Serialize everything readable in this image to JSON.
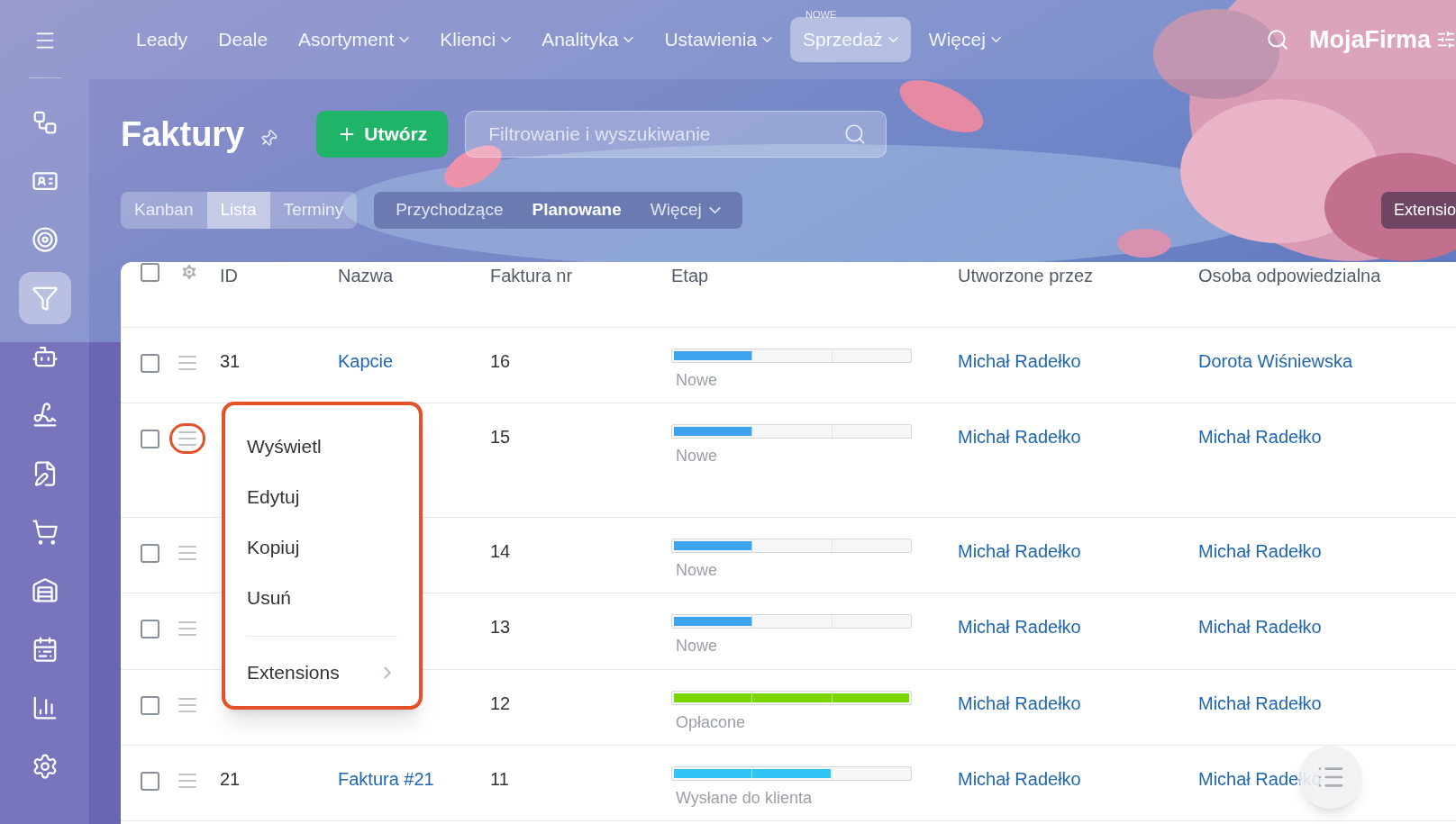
{
  "sidebar": {
    "items": [
      {
        "selected": false
      },
      {
        "selected": false
      },
      {
        "selected": false
      },
      {
        "selected": true
      },
      {
        "selected": false
      },
      {
        "selected": false
      },
      {
        "selected": false
      },
      {
        "selected": false
      },
      {
        "selected": false
      },
      {
        "selected": false
      },
      {
        "selected": false
      },
      {
        "selected": false
      }
    ]
  },
  "top_nav": {
    "items": [
      {
        "label": "Leady",
        "dropdown": false,
        "selected": false
      },
      {
        "label": "Deale",
        "dropdown": false,
        "selected": false
      },
      {
        "label": "Asortyment",
        "dropdown": true,
        "selected": false
      },
      {
        "label": "Klienci",
        "dropdown": true,
        "selected": false
      },
      {
        "label": "Analityka",
        "dropdown": true,
        "selected": false
      },
      {
        "label": "Ustawienia",
        "dropdown": true,
        "selected": false
      },
      {
        "label": "Sprzedaż",
        "dropdown": true,
        "selected": true,
        "badge": "NOWE"
      },
      {
        "label": "Więcej",
        "dropdown": true,
        "selected": false
      }
    ],
    "logo": "MojaFirma"
  },
  "header": {
    "title": "Faktury",
    "create_button": "Utwórz",
    "search": {
      "placeholder": "Filtrowanie i wyszukiwanie"
    },
    "view_tabs": [
      {
        "label": "Kanban",
        "selected": false
      },
      {
        "label": "Lista",
        "selected": true
      },
      {
        "label": "Terminy",
        "selected": false
      }
    ],
    "filter_tabs": [
      {
        "label": "Przychodzące",
        "selected": false,
        "dropdown": false
      },
      {
        "label": "Planowane",
        "selected": true,
        "dropdown": false
      },
      {
        "label": "Więcej",
        "selected": false,
        "dropdown": true
      }
    ],
    "extensions_button": "Extensio"
  },
  "table": {
    "all_checked": false,
    "columns": [
      "ID",
      "Nazwa",
      "Faktura nr",
      "Etap",
      "Utworzone przez",
      "Osoba odpowiedzialna"
    ],
    "rows": [
      {
        "checked": false,
        "highlighted": false,
        "id": "31",
        "name": "Kapcie",
        "invoice_no": "16",
        "stage": {
          "label": "Nowe",
          "level": 0.333,
          "color": "#3ba4ec"
        },
        "created_by": "Michał Radełko",
        "responsible": "Dorota Wiśniewska"
      },
      {
        "checked": false,
        "highlighted": true,
        "invoice_no": "15",
        "stage": {
          "label": "Nowe",
          "level": 0.333,
          "color": "#3ba4ec"
        },
        "created_by": "Michał Radełko",
        "responsible": "Michał Radełko"
      },
      {
        "checked": false,
        "highlighted": false,
        "invoice_no": "14",
        "stage": {
          "label": "Nowe",
          "level": 0.333,
          "color": "#3ba4ec"
        },
        "created_by": "Michał Radełko",
        "responsible": "Michał Radełko"
      },
      {
        "checked": false,
        "highlighted": false,
        "invoice_no": "13",
        "stage": {
          "label": "Nowe",
          "level": 0.333,
          "color": "#3ba4ec"
        },
        "created_by": "Michał Radełko",
        "responsible": "Michał Radełko"
      },
      {
        "checked": false,
        "highlighted": false,
        "invoice_no": "12",
        "stage": {
          "label": "Opłacone",
          "level": 1,
          "color": "#7bd500"
        },
        "created_by": "Michał Radełko",
        "responsible": "Michał Radełko"
      },
      {
        "checked": false,
        "highlighted": false,
        "id": "21",
        "name": "Faktura #21",
        "invoice_no": "11",
        "stage": {
          "label": "Wysłane do klienta",
          "level": 0.667,
          "color": "#2fc6f6"
        },
        "created_by": "Michał Radełko",
        "responsible": "Michał Radełko"
      }
    ]
  },
  "context_menu": {
    "items": [
      {
        "kind": "action",
        "label": "Wyświetl"
      },
      {
        "kind": "action",
        "label": "Edytuj"
      },
      {
        "kind": "action",
        "label": "Kopiuj"
      },
      {
        "kind": "action",
        "label": "Usuń"
      },
      {
        "kind": "submenu",
        "label": "Extensions"
      }
    ]
  }
}
